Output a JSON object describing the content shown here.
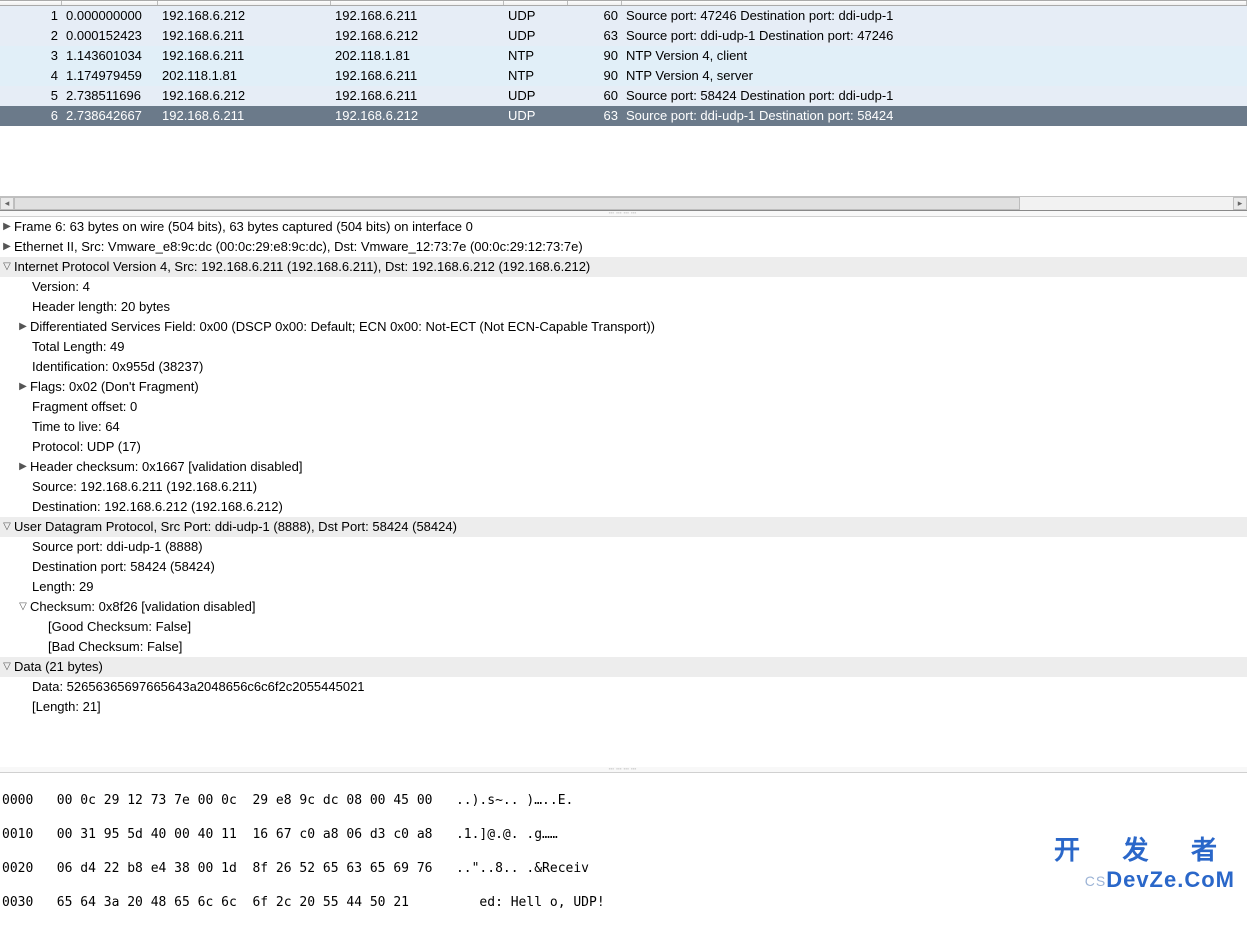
{
  "packets": [
    {
      "no": "1",
      "time": "0.000000000",
      "src": "192.168.6.212",
      "dst": "192.168.6.211",
      "proto": "UDP",
      "len": "60",
      "info": "Source port: 47246  Destination port: ddi-udp-1",
      "cls": "row-udp"
    },
    {
      "no": "2",
      "time": "0.000152423",
      "src": "192.168.6.211",
      "dst": "192.168.6.212",
      "proto": "UDP",
      "len": "63",
      "info": "Source port: ddi-udp-1  Destination port: 47246",
      "cls": "row-udp"
    },
    {
      "no": "3",
      "time": "1.143601034",
      "src": "192.168.6.211",
      "dst": "202.118.1.81",
      "proto": "NTP",
      "len": "90",
      "info": "NTP Version 4, client",
      "cls": "row-ntp"
    },
    {
      "no": "4",
      "time": "1.174979459",
      "src": "202.118.1.81",
      "dst": "192.168.6.211",
      "proto": "NTP",
      "len": "90",
      "info": "NTP Version 4, server",
      "cls": "row-ntp"
    },
    {
      "no": "5",
      "time": "2.738511696",
      "src": "192.168.6.212",
      "dst": "192.168.6.211",
      "proto": "UDP",
      "len": "60",
      "info": "Source port: 58424  Destination port: ddi-udp-1",
      "cls": "row-udp"
    },
    {
      "no": "6",
      "time": "2.738642667",
      "src": "192.168.6.211",
      "dst": "192.168.6.212",
      "proto": "UDP",
      "len": "63",
      "info": "Source port: ddi-udp-1  Destination port: 58424",
      "cls": "row-selected"
    }
  ],
  "tree": {
    "frame": "Frame 6: 63 bytes on wire (504 bits), 63 bytes captured (504 bits) on interface 0",
    "eth": "Ethernet II, Src: Vmware_e8:9c:dc (00:0c:29:e8:9c:dc), Dst: Vmware_12:73:7e (00:0c:29:12:73:7e)",
    "ip": "Internet Protocol Version 4, Src: 192.168.6.211 (192.168.6.211), Dst: 192.168.6.212 (192.168.6.212)",
    "ip_version": "Version: 4",
    "ip_hlen": "Header length: 20 bytes",
    "ip_dscp": "Differentiated Services Field: 0x00 (DSCP 0x00: Default; ECN 0x00: Not-ECT (Not ECN-Capable Transport))",
    "ip_total": "Total Length: 49",
    "ip_id": "Identification: 0x955d (38237)",
    "ip_flags": "Flags: 0x02 (Don't Fragment)",
    "ip_frag": "Fragment offset: 0",
    "ip_ttl": "Time to live: 64",
    "ip_proto": "Protocol: UDP (17)",
    "ip_chk": "Header checksum: 0x1667 [validation disabled]",
    "ip_src": "Source: 192.168.6.211 (192.168.6.211)",
    "ip_dst": "Destination: 192.168.6.212 (192.168.6.212)",
    "udp": "User Datagram Protocol, Src Port: ddi-udp-1 (8888), Dst Port: 58424 (58424)",
    "udp_src": "Source port: ddi-udp-1 (8888)",
    "udp_dst": "Destination port: 58424 (58424)",
    "udp_len": "Length: 29",
    "udp_chk": "Checksum: 0x8f26 [validation disabled]",
    "udp_good": "[Good Checksum: False]",
    "udp_bad": "[Bad Checksum: False]",
    "data": "Data (21 bytes)",
    "data_data": "Data: 52656365697665643a2048656c6c6f2c2055445021",
    "data_len": "[Length: 21]"
  },
  "hex": {
    "l0": "0000   00 0c 29 12 73 7e 00 0c  29 e8 9c dc 08 00 45 00   ..).s~.. )…..E.",
    "l1": "0010   00 31 95 5d 40 00 40 11  16 67 c0 a8 06 d3 c0 a8   .1.]@.@. .g……",
    "l2": "0020   06 d4 22 b8 e4 38 00 1d  8f 26 52 65 63 65 69 76   ..\"..8.. .&Receiv",
    "l3": "0030   65 64 3a 20 48 65 6c 6c  6f 2c 20 55 44 50 21         ed: Hell o, UDP!"
  },
  "watermark": {
    "top": "开 发 者",
    "csdn": "CS",
    "dz": "DevZe.CoM"
  },
  "icons": {
    "tri_right": "▶",
    "tri_down": "▽",
    "scroll_left": "◂",
    "scroll_right": "▸",
    "sash_dots": "┄┄┄┄"
  }
}
